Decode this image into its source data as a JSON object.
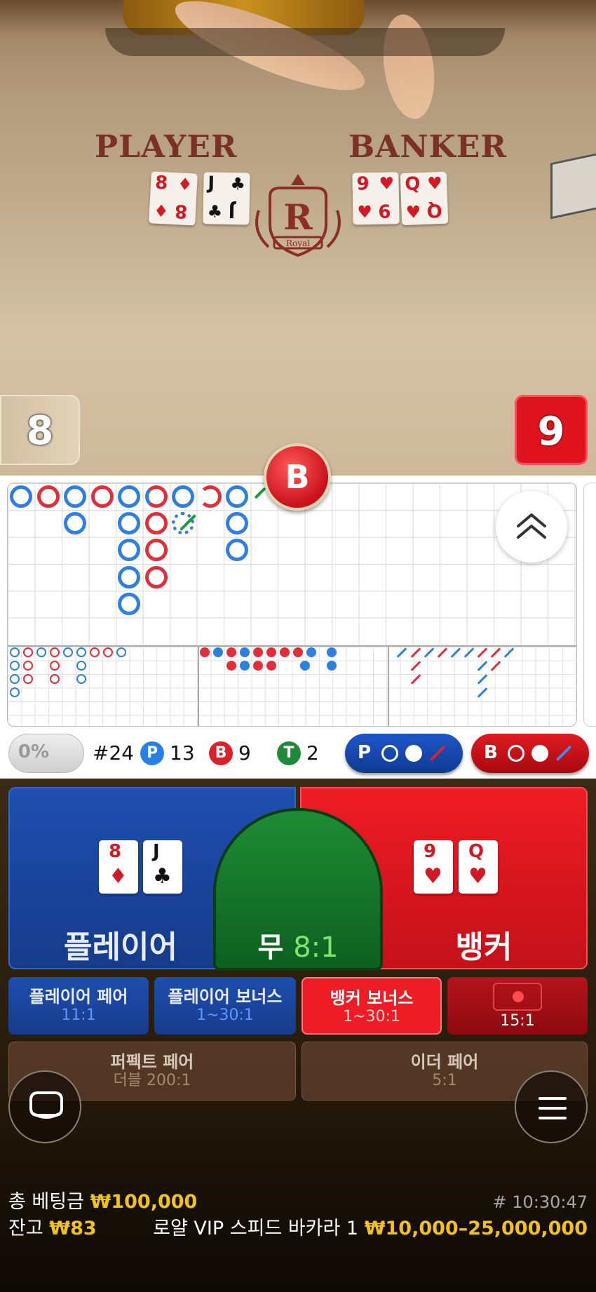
{
  "table": {
    "player_label": "PLAYER",
    "banker_label": "BANKER",
    "crest_letter": "R",
    "crest_text": "Royal"
  },
  "cards": {
    "player": [
      {
        "rank": "8",
        "suit": "♦",
        "color": "red"
      },
      {
        "rank": "J",
        "suit": "♣",
        "color": "black"
      }
    ],
    "banker": [
      {
        "rank": "9",
        "suit": "♥",
        "color": "red"
      },
      {
        "rank": "Q",
        "suit": "♥",
        "color": "red"
      }
    ]
  },
  "scores": {
    "player": "8",
    "banker": "9"
  },
  "result_badge": "B",
  "stats": {
    "percent": "0%",
    "round": "#24",
    "p_chip": "P",
    "p_count": "13",
    "b_chip": "B",
    "b_count": "9",
    "t_chip": "T",
    "t_count": "2"
  },
  "predict": {
    "player": "P",
    "banker": "B"
  },
  "bets": {
    "player": "플레이어",
    "tie": "무",
    "tie_odds": "8:1",
    "banker": "뱅커",
    "player_pair": "플레이어 페어",
    "player_pair_odds": "11:1",
    "player_bonus": "플레이어 보너스",
    "player_bonus_odds": "1~30:1",
    "banker_bonus": "뱅커 보너스",
    "banker_bonus_odds": "1~30:1",
    "banker_pair_odds": "15:1",
    "perfect_pair": "퍼펙트 페어",
    "perfect_pair_odds": "더블 200:1",
    "either_pair": "이더 페어",
    "either_pair_odds": "5:1"
  },
  "footer": {
    "total_bet_label": "총 베팅금",
    "total_bet": "₩100,000",
    "balance_label": "잔고",
    "balance": "₩83",
    "time": "# 10:30:47",
    "table_name": "로얄 VIP 스피드 바카라 1",
    "limits": "₩10,000–25,000,000"
  },
  "colors": {
    "player": "#1f55b5",
    "banker": "#e01b22",
    "tie": "#1f8a2e",
    "gold": "#f2c21a"
  },
  "icons": {
    "expand": "double-chevron-up-icon",
    "chat": "chat-bubble-icon",
    "menu": "hamburger-menu-icon"
  }
}
